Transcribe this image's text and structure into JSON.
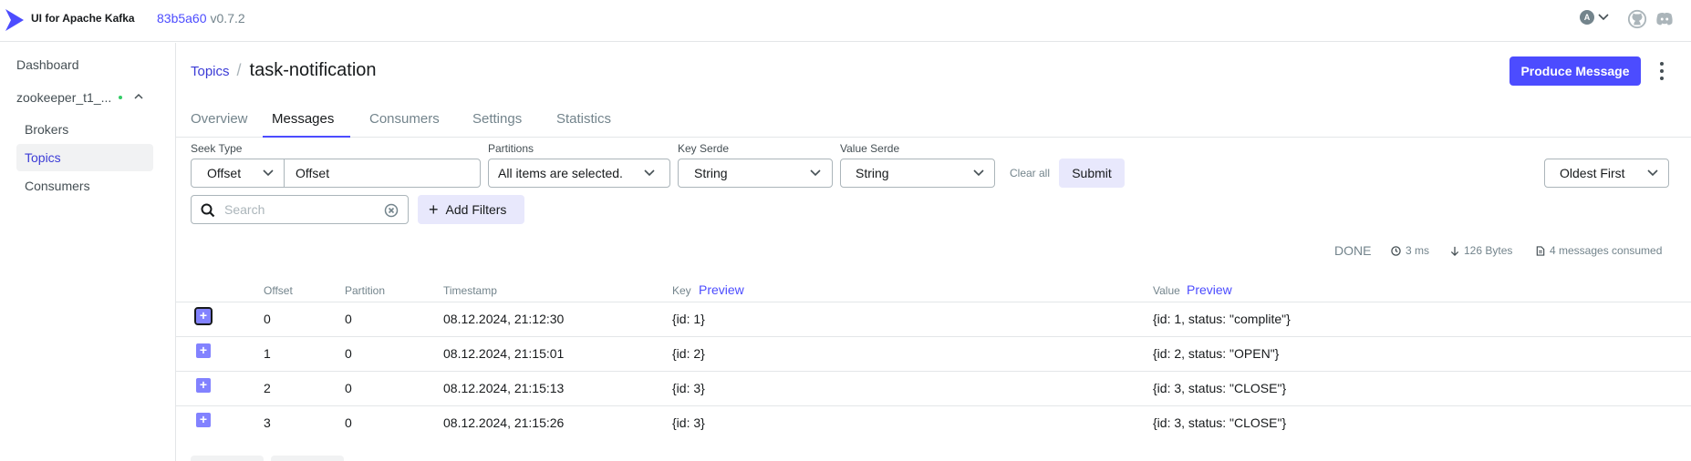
{
  "header": {
    "app_title": "UI for Apache Kafka",
    "commit": "83b5a60",
    "version": "v0.7.2",
    "user_initial": "A",
    "icons": [
      "github-icon",
      "discord-icon"
    ]
  },
  "sidebar": {
    "dashboard": "Dashboard",
    "cluster": "zookeeper_t1_...",
    "items": [
      {
        "label": "Brokers"
      },
      {
        "label": "Topics",
        "active": true
      },
      {
        "label": "Consumers"
      }
    ]
  },
  "breadcrumb": {
    "parent": "Topics",
    "separator": "/",
    "current": "task-notification"
  },
  "actions": {
    "produce_label": "Produce Message"
  },
  "tabs": [
    {
      "label": "Overview"
    },
    {
      "label": "Messages",
      "active": true
    },
    {
      "label": "Consumers"
    },
    {
      "label": "Settings"
    },
    {
      "label": "Statistics"
    }
  ],
  "filters": {
    "seek_type_label": "Seek Type",
    "seek_type_value": "Offset",
    "offset_value": "Offset",
    "partitions_label": "Partitions",
    "partitions_value": "All items are selected.",
    "key_serde_label": "Key Serde",
    "key_serde_value": "String",
    "value_serde_label": "Value Serde",
    "value_serde_value": "String",
    "clear_all": "Clear all",
    "submit": "Submit",
    "sort_value": "Oldest First",
    "search_placeholder": "Search",
    "add_filters": "Add Filters"
  },
  "status": {
    "state": "DONE",
    "time": "3 ms",
    "bytes": "126 Bytes",
    "consumed": "4 messages consumed"
  },
  "table": {
    "columns": {
      "offset": "Offset",
      "partition": "Partition",
      "timestamp": "Timestamp",
      "key": "Key",
      "value": "Value",
      "preview": "Preview"
    },
    "rows": [
      {
        "offset": "0",
        "partition": "0",
        "timestamp": "08.12.2024, 21:12:30",
        "key": "{id: 1}",
        "value": "{id: 1, status: \"complite\"}"
      },
      {
        "offset": "1",
        "partition": "0",
        "timestamp": "08.12.2024, 21:15:01",
        "key": "{id: 2}",
        "value": "{id: 2, status: \"OPEN\"}"
      },
      {
        "offset": "2",
        "partition": "0",
        "timestamp": "08.12.2024, 21:15:13",
        "key": "{id: 3}",
        "value": "{id: 3, status: \"CLOSE\"}"
      },
      {
        "offset": "3",
        "partition": "0",
        "timestamp": "08.12.2024, 21:15:26",
        "key": "{id: 3}",
        "value": "{id: 3, status: \"CLOSE\"}"
      }
    ]
  },
  "colors": {
    "accent": "#4c4cff",
    "accent_soft": "#e8e8fc",
    "expand": "#8282ff",
    "online": "#33cc66"
  }
}
